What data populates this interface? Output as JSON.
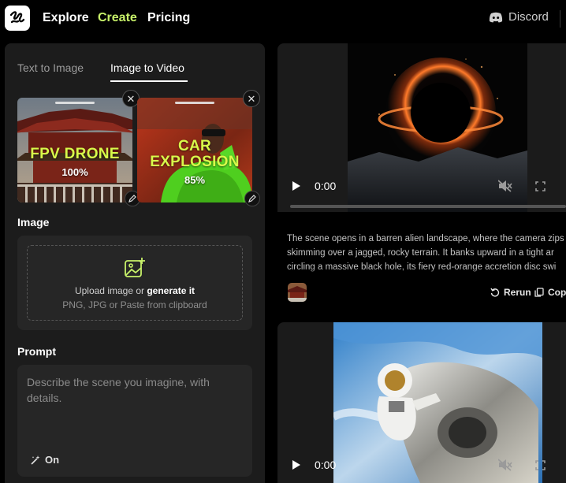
{
  "nav": {
    "links": [
      {
        "label": "Explore",
        "active": false
      },
      {
        "label": "Create",
        "active": true
      },
      {
        "label": "Pricing",
        "active": false
      }
    ],
    "discord_label": "Discord",
    "accent_color": "#c8f26a"
  },
  "panel": {
    "tabs": [
      "Text to Image",
      "Image to Video"
    ],
    "active_tab": "Image to Video",
    "presets": [
      {
        "title_line1": "FPV DRONE",
        "title_line2": "",
        "percent": "100%"
      },
      {
        "title_line1": "CAR",
        "title_line2": "EXPLOSION",
        "percent": "85%"
      }
    ],
    "image_label": "Image",
    "upload": {
      "line1_prefix": "Upload image or ",
      "line1_link": "generate it",
      "line2": "PNG, JPG or Paste from clipboard"
    },
    "prompt_label": "Prompt",
    "prompt_placeholder": "Describe the scene you imagine, with details.",
    "enhance_label": "On"
  },
  "feed": {
    "videos": [
      {
        "time": "0:00",
        "subject": "black-hole"
      },
      {
        "time": "0:00",
        "subject": "astronaut-space-station"
      }
    ],
    "description_lines": [
      "The scene opens in a barren alien landscape, where the camera zips",
      "skimming over a jagged, rocky terrain. It banks upward in a tight ar",
      "circling a massive black hole, its fiery red-orange accretion disc swi"
    ],
    "actions": {
      "rerun": "Rerun",
      "copy": "Copy"
    }
  }
}
